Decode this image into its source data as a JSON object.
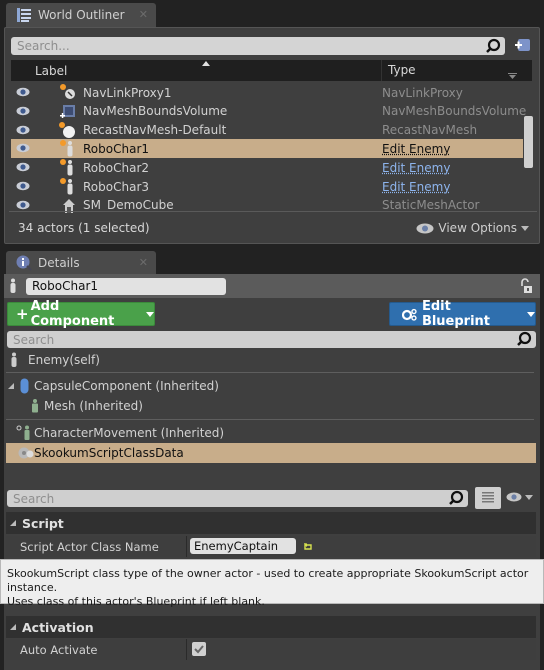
{
  "outliner": {
    "tab_title": "World Outliner",
    "tab_icon": "list-icon",
    "search_placeholder": "Search...",
    "columns": {
      "label": "Label",
      "type": "Type"
    },
    "rows": [
      {
        "name": "NavLinkProxy1",
        "type": "NavLinkProxy",
        "type_is_link": false,
        "selected": false,
        "icon": "nav-link-proxy-icon"
      },
      {
        "name": "NavMeshBoundsVolume",
        "type": "NavMeshBoundsVolume",
        "type_is_link": false,
        "selected": false,
        "icon": "volume-icon"
      },
      {
        "name": "RecastNavMesh-Default",
        "type": "RecastNavMesh",
        "type_is_link": false,
        "selected": false,
        "icon": "sphere-icon"
      },
      {
        "name": "RoboChar1",
        "type": "Edit Enemy",
        "type_is_link": true,
        "selected": true,
        "icon": "character-icon"
      },
      {
        "name": "RoboChar2",
        "type": "Edit Enemy",
        "type_is_link": true,
        "selected": false,
        "icon": "character-icon"
      },
      {
        "name": "RoboChar3",
        "type": "Edit Enemy",
        "type_is_link": true,
        "selected": false,
        "icon": "character-icon"
      },
      {
        "name": "SM_DemoCube",
        "type": "StaticMeshActor",
        "type_is_link": false,
        "selected": false,
        "icon": "static-mesh-icon"
      }
    ],
    "actor_count": "34 actors (1 selected)",
    "view_options": "View Options"
  },
  "details": {
    "tab_title": "Details",
    "tab_icon": "info-icon",
    "actor_name": "RoboChar1",
    "add_component": "Add Component",
    "edit_blueprint": "Edit Blueprint",
    "component_search_placeholder": "Search",
    "components": [
      {
        "label": "Enemy(self)",
        "icon": "character-icon"
      },
      {
        "label": "CapsuleComponent (Inherited)",
        "icon": "capsule-icon"
      },
      {
        "label": "Mesh (Inherited)",
        "icon": "mesh-icon"
      },
      {
        "label": "CharacterMovement (Inherited)",
        "icon": "movement-icon"
      },
      {
        "label": "SkookumScriptClassData",
        "icon": "gear-component-icon",
        "selected": true
      }
    ],
    "property_search_placeholder": "Search",
    "sections": [
      {
        "title": "Script",
        "properties": [
          {
            "name": "Script Actor Class Name",
            "value": "EnemyCaptain"
          }
        ]
      },
      {
        "title": "Activation",
        "properties": [
          {
            "name": "Auto Activate",
            "checked": true
          }
        ]
      }
    ],
    "tooltip": {
      "line1": "SkookumScript class type of the owner actor - used to create appropriate SkookumScript actor instance.",
      "line2": "Uses class of this actor's Blueprint if left blank."
    }
  }
}
